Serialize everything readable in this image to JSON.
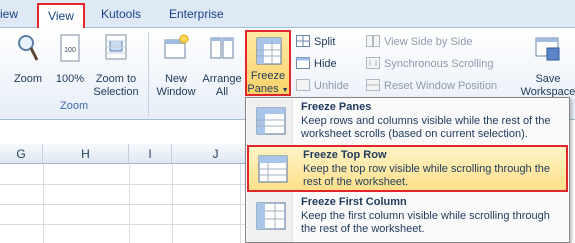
{
  "tabs": {
    "left_partial": "iew",
    "view": "View",
    "kutools": "Kutools",
    "enterprise": "Enterprise"
  },
  "zoom_group": {
    "label": "Zoom",
    "zoom": "Zoom",
    "zoom100": "100%",
    "zoom_to_sel_1": "Zoom to",
    "zoom_to_sel_2": "Selection"
  },
  "window_group": {
    "new_window_1": "New",
    "new_window_2": "Window",
    "arrange_1": "Arrange",
    "arrange_2": "All",
    "freeze_1": "Freeze",
    "freeze_2": "Panes",
    "split": "Split",
    "hide": "Hide",
    "unhide": "Unhide",
    "side_by_side": "View Side by Side",
    "sync_scroll": "Synchronous Scrolling",
    "reset_pos": "Reset Window Position",
    "save_ws_1": "Save",
    "save_ws_2": "Workspace"
  },
  "sheet": {
    "columns": [
      "G",
      "H",
      "I",
      "J"
    ]
  },
  "menu": {
    "items": [
      {
        "title": "Freeze Panes",
        "desc": "Keep rows and columns visible while the rest of the worksheet scrolls (based on current selection)."
      },
      {
        "title": "Freeze Top Row",
        "desc": "Keep the top row visible while scrolling through the rest of the worksheet."
      },
      {
        "title": "Freeze First Column",
        "desc": "Keep the first column visible while scrolling through the rest of the worksheet."
      }
    ]
  },
  "colors": {
    "highlight_border": "#e0262b",
    "accent_text": "#1e395b"
  }
}
